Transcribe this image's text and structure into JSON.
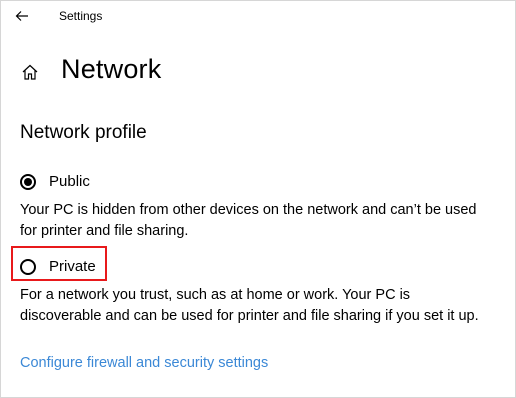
{
  "window": {
    "title": "Settings"
  },
  "icons": {
    "back": "back-arrow-icon",
    "home": "home-icon"
  },
  "page": {
    "title": "Network"
  },
  "network_profile": {
    "heading": "Network profile",
    "options": [
      {
        "label": "Public",
        "selected": true,
        "description": "Your PC is hidden from other devices on the network and can’t be used for printer and file sharing."
      },
      {
        "label": "Private",
        "selected": false,
        "description": "For a network you trust, such as at home or work. Your PC is discoverable and can be used for printer and file sharing if you set it up."
      }
    ]
  },
  "links": {
    "firewall": "Configure firewall and security settings"
  },
  "colors": {
    "link": "#3b88d6",
    "highlight_border": "#e8191b"
  }
}
